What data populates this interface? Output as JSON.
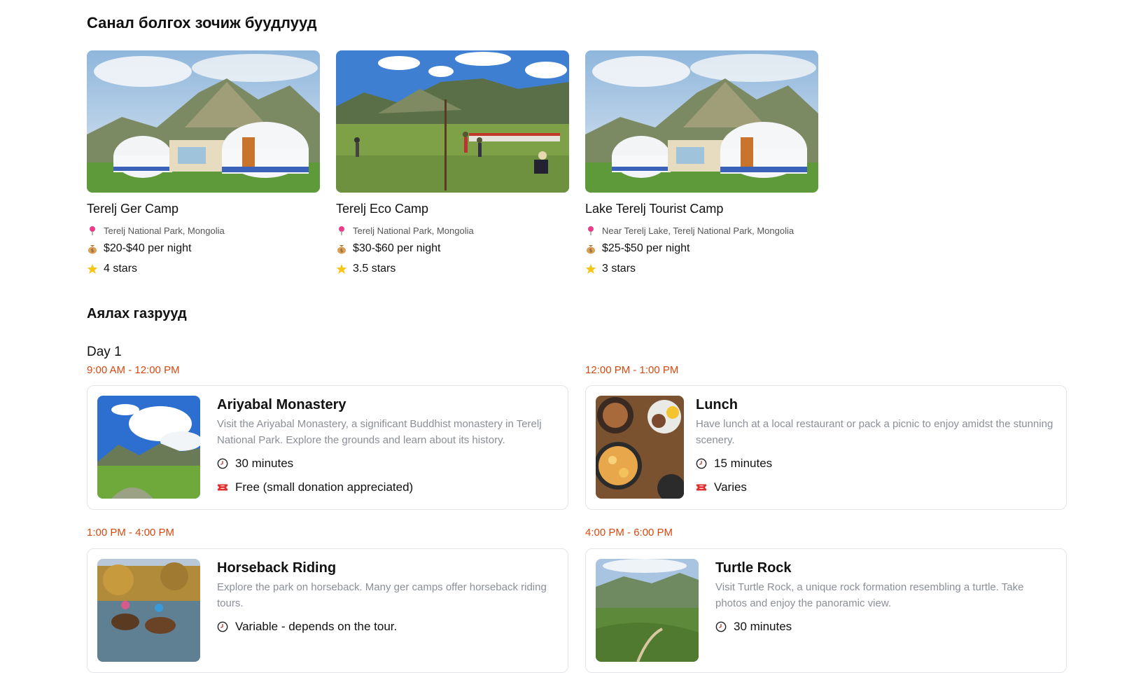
{
  "recommended": {
    "title": "Санал болгох зочиж буудлууд",
    "camps": [
      {
        "name": "Terelj Ger Camp",
        "location": "Terelj National Park, Mongolia",
        "price": "$20-$40 per night",
        "rating": "4 stars"
      },
      {
        "name": "Terelj Eco Camp",
        "location": "Terelj National Park, Mongolia",
        "price": "$30-$60 per night",
        "rating": "3.5 stars"
      },
      {
        "name": "Lake Terelj Tourist Camp",
        "location": "Near Terelj Lake, Terelj National Park, Mongolia",
        "price": "$25-$50 per night",
        "rating": "3 stars"
      }
    ]
  },
  "places": {
    "title": "Аялах газрууд",
    "day_label": "Day 1",
    "activities": [
      {
        "time": "9:00 AM - 12:00 PM",
        "title": "Ariyabal Monastery",
        "description": "Visit the Ariyabal Monastery, a significant Buddhist monastery in Terelj National Park. Explore the grounds and learn about its history.",
        "duration": "30 minutes",
        "cost": "Free (small donation appreciated)"
      },
      {
        "time": "12:00 PM - 1:00 PM",
        "title": "Lunch",
        "description": "Have lunch at a local restaurant or pack a picnic to enjoy amidst the stunning scenery.",
        "duration": "15 minutes",
        "cost": "Varies"
      },
      {
        "time": "1:00 PM - 4:00 PM",
        "title": "Horseback Riding",
        "description": "Explore the park on horseback. Many ger camps offer horseback riding tours.",
        "duration": "Variable - depends on the tour.",
        "cost": ""
      },
      {
        "time": "4:00 PM - 6:00 PM",
        "title": "Turtle Rock",
        "description": "Visit Turtle Rock, a unique rock formation resembling a turtle. Take photos and enjoy the panoramic view.",
        "duration": "30 minutes",
        "cost": ""
      }
    ]
  },
  "icons": {
    "location": "map-pin-icon",
    "price": "money-bag-icon",
    "rating": "star-icon",
    "duration": "clock-icon",
    "cost": "ticket-icon"
  },
  "colors": {
    "time_accent": "#d9480f",
    "pin": "#e83e8c",
    "star": "#f5c518",
    "ticket": "#e03131"
  }
}
